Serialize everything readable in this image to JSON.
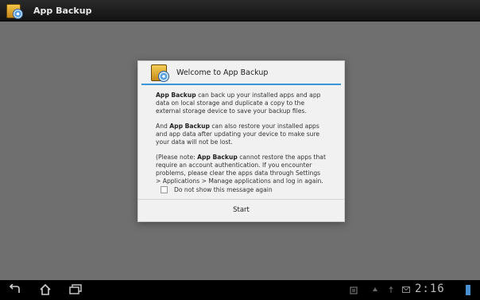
{
  "action_bar": {
    "title": "App Backup"
  },
  "dialog": {
    "title": "Welcome to App Backup",
    "paragraphs": [
      {
        "app": "App Backup",
        "text": " can back up your installed apps and app data on local storage and duplicate a copy to the external storage device to save your backup files."
      },
      {
        "prefix": "And ",
        "app": "App Backup",
        "text": " can also restore your installed apps and app data after updating your device to make sure your data will not be lost."
      },
      {
        "prefix": "(Please note: ",
        "app": "App Backup",
        "text": " cannot restore the apps that require an account authentication. If you encounter problems, please clear the apps data through Settings > Applications > Manage applications and log in again."
      }
    ],
    "checkbox_label": "Do not show this message again",
    "checkbox_checked": false,
    "start_label": "Start"
  },
  "system_bar": {
    "time": "2:16"
  },
  "colors": {
    "accent": "#3a96d6",
    "dim_background": "#6f6f6f"
  },
  "icons": [
    "app-backup-icon",
    "back-icon",
    "home-icon",
    "recent-apps-icon",
    "screenshot-icon",
    "wifi-icon",
    "usb-icon",
    "email-icon"
  ]
}
